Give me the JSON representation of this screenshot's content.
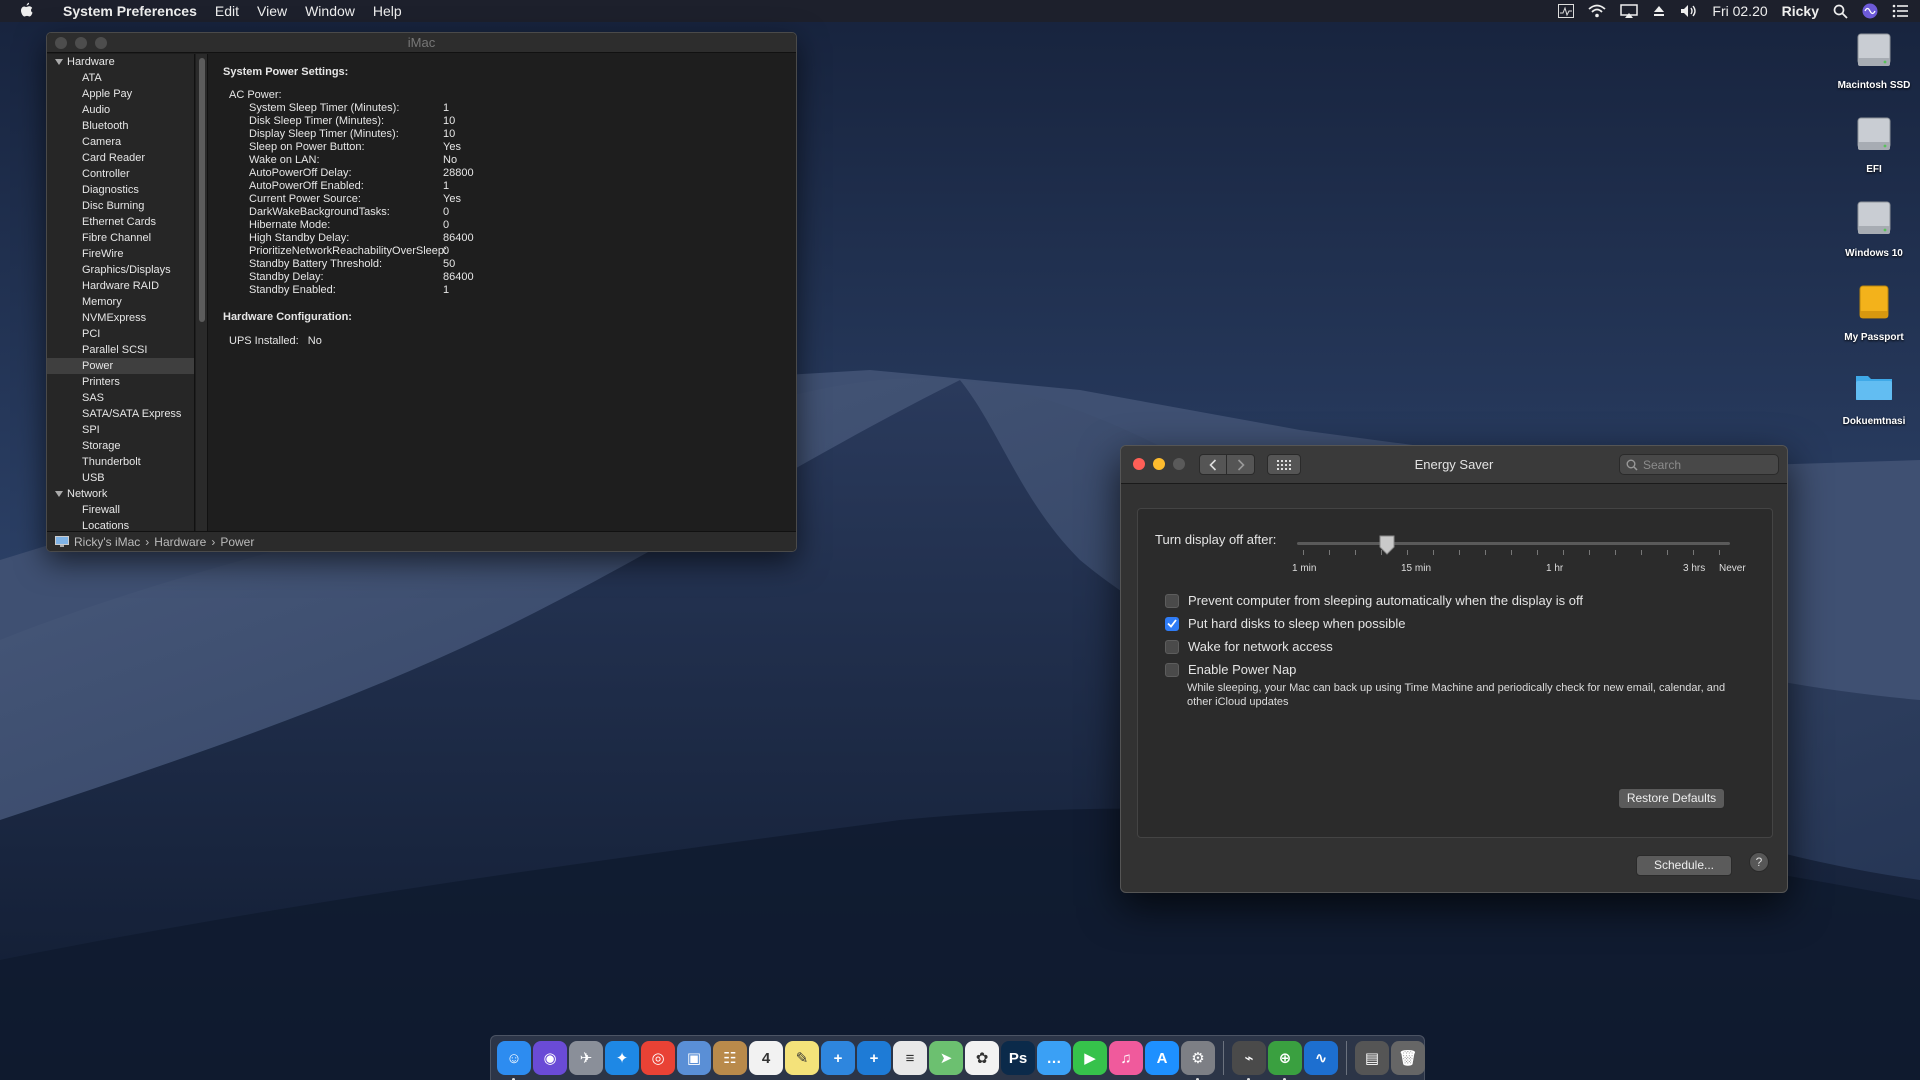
{
  "menubar": {
    "app_name": "System Preferences",
    "menus": [
      "Edit",
      "View",
      "Window",
      "Help"
    ],
    "clock": "Fri 02.20",
    "user": "Ricky"
  },
  "sysinfo": {
    "title": "iMac",
    "sidebar": {
      "group_hardware": "Hardware",
      "hardware_items": [
        "ATA",
        "Apple Pay",
        "Audio",
        "Bluetooth",
        "Camera",
        "Card Reader",
        "Controller",
        "Diagnostics",
        "Disc Burning",
        "Ethernet Cards",
        "Fibre Channel",
        "FireWire",
        "Graphics/Displays",
        "Hardware RAID",
        "Memory",
        "NVMExpress",
        "PCI",
        "Parallel SCSI",
        "Power",
        "Printers",
        "SAS",
        "SATA/SATA Express",
        "SPI",
        "Storage",
        "Thunderbolt",
        "USB"
      ],
      "selected": "Power",
      "group_network": "Network",
      "network_items": [
        "Firewall",
        "Locations"
      ]
    },
    "content": {
      "heading": "System Power Settings:",
      "subheading": "AC Power:",
      "rows": [
        {
          "k": "System Sleep Timer (Minutes):",
          "v": "1"
        },
        {
          "k": "Disk Sleep Timer (Minutes):",
          "v": "10"
        },
        {
          "k": "Display Sleep Timer (Minutes):",
          "v": "10"
        },
        {
          "k": "Sleep on Power Button:",
          "v": "Yes"
        },
        {
          "k": "Wake on LAN:",
          "v": "No"
        },
        {
          "k": "AutoPowerOff Delay:",
          "v": "28800"
        },
        {
          "k": "AutoPowerOff Enabled:",
          "v": "1"
        },
        {
          "k": "Current Power Source:",
          "v": "Yes"
        },
        {
          "k": "DarkWakeBackgroundTasks:",
          "v": "0"
        },
        {
          "k": "Hibernate Mode:",
          "v": "0"
        },
        {
          "k": "High Standby Delay:",
          "v": "86400"
        },
        {
          "k": "PrioritizeNetworkReachabilityOverSleep:",
          "v": "0"
        },
        {
          "k": "Standby Battery Threshold:",
          "v": "50"
        },
        {
          "k": "Standby Delay:",
          "v": "86400"
        },
        {
          "k": "Standby Enabled:",
          "v": "1"
        }
      ],
      "heading2": "Hardware Configuration:",
      "ups_label": "UPS Installed:",
      "ups_value": "No"
    },
    "pathbar": [
      "Ricky's iMac",
      "Hardware",
      "Power"
    ]
  },
  "energy": {
    "title": "Energy Saver",
    "search_placeholder": "Search",
    "display_off_label": "Turn display off after:",
    "slider_value_minutes": 10,
    "tick_labels": [
      "1 min",
      "15 min",
      "1 hr",
      "3 hrs",
      "Never"
    ],
    "checkboxes": [
      {
        "label": "Prevent computer from sleeping automatically when the display is off",
        "checked": false
      },
      {
        "label": "Put hard disks to sleep when possible",
        "checked": true
      },
      {
        "label": "Wake for network access",
        "checked": false
      },
      {
        "label": "Enable Power Nap",
        "checked": false
      }
    ],
    "power_nap_desc": "While sleeping, your Mac can back up using Time Machine and periodically check for new email, calendar, and other iCloud updates",
    "restore_label": "Restore Defaults",
    "schedule_label": "Schedule...",
    "help_label": "?"
  },
  "desktop_icons": [
    {
      "label": "Macintosh SSD",
      "icon": "hard-drive-icon"
    },
    {
      "label": "EFI",
      "icon": "hard-drive-icon"
    },
    {
      "label": "Windows 10",
      "icon": "hard-drive-icon"
    },
    {
      "label": "My Passport",
      "icon": "external-drive-icon"
    },
    {
      "label": "Dokuemtnasi",
      "icon": "folder-icon"
    }
  ],
  "dock": {
    "apps": [
      {
        "name": "finder",
        "glyph": "☺",
        "color": "#2d8cf0"
      },
      {
        "name": "siri",
        "glyph": "◉",
        "color": "#6a4bd6"
      },
      {
        "name": "launchpad",
        "glyph": "✈",
        "color": "#8a8f99"
      },
      {
        "name": "safari",
        "glyph": "✦",
        "color": "#1e88e5"
      },
      {
        "name": "chrome",
        "glyph": "◎",
        "color": "#e94235"
      },
      {
        "name": "preview",
        "glyph": "▣",
        "color": "#5a8fd6"
      },
      {
        "name": "contacts",
        "glyph": "☷",
        "color": "#b98a4b"
      },
      {
        "name": "calendar",
        "glyph": "4",
        "color": "#f2f2f2"
      },
      {
        "name": "notes",
        "glyph": "✎",
        "color": "#f4e27a"
      },
      {
        "name": "add-app-1",
        "glyph": "+",
        "color": "#2e86de"
      },
      {
        "name": "add-app-2",
        "glyph": "+",
        "color": "#1e7bd6"
      },
      {
        "name": "textedit",
        "glyph": "≡",
        "color": "#e8e8e8"
      },
      {
        "name": "maps",
        "glyph": "➤",
        "color": "#6cc070"
      },
      {
        "name": "photos",
        "glyph": "✿",
        "color": "#f2f2f2"
      },
      {
        "name": "photoshop",
        "glyph": "Ps",
        "color": "#0b2a4a"
      },
      {
        "name": "messages",
        "glyph": "…",
        "color": "#3aa0f5"
      },
      {
        "name": "facetime",
        "glyph": "▶",
        "color": "#36c24b"
      },
      {
        "name": "itunes",
        "glyph": "♫",
        "color": "#f05a9c"
      },
      {
        "name": "app-store",
        "glyph": "A",
        "color": "#1e90ff"
      },
      {
        "name": "system-preferences",
        "glyph": "⚙",
        "color": "#7d7f85"
      },
      {
        "name": "sep"
      },
      {
        "name": "utility",
        "glyph": "⌁",
        "color": "#4a4a4a"
      },
      {
        "name": "network-globe",
        "glyph": "⊕",
        "color": "#3aa040"
      },
      {
        "name": "activity-monitor",
        "glyph": "∿",
        "color": "#1d6fd0"
      },
      {
        "name": "sep"
      },
      {
        "name": "downloads",
        "glyph": "▤",
        "color": "#555"
      },
      {
        "name": "trash",
        "glyph": "🗑",
        "color": "#666"
      }
    ]
  }
}
